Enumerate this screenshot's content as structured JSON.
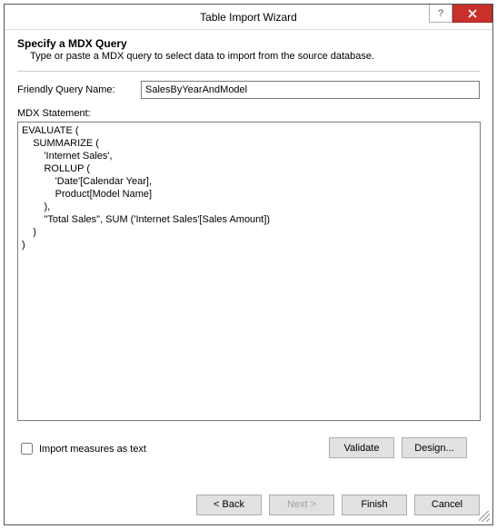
{
  "window": {
    "title": "Table Import Wizard"
  },
  "header": {
    "title": "Specify a MDX Query",
    "subtitle": "Type or paste a MDX query to select data to import from the source database."
  },
  "form": {
    "name_label": "Friendly Query Name:",
    "name_value": "SalesByYearAndModel",
    "stmt_label": "MDX Statement:",
    "stmt_value": "EVALUATE (\n    SUMMARIZE (\n        'Internet Sales',\n        ROLLUP (\n            'Date'[Calendar Year],\n            Product[Model Name]\n        ),\n        \"Total Sales\", SUM ('Internet Sales'[Sales Amount])\n    )\n)",
    "import_checkbox_label": "Import measures as text",
    "import_checked": false
  },
  "buttons": {
    "validate": "Validate",
    "design": "Design...",
    "back": "< Back",
    "next": "Next >",
    "finish": "Finish",
    "cancel": "Cancel"
  }
}
